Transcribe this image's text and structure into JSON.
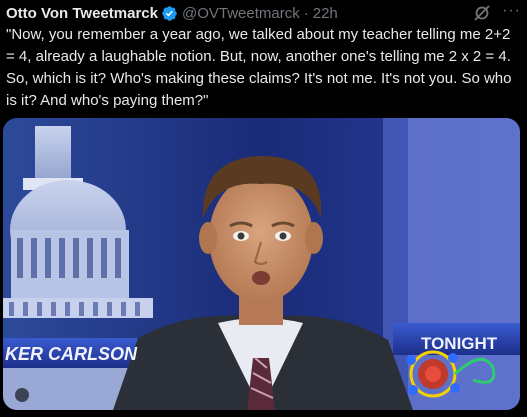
{
  "tweet": {
    "author_name": "Otto Von Tweetmarck",
    "handle": "@OVTweetmarck",
    "separator": "·",
    "time": "22h",
    "more_glyph": "···",
    "text": "\"Now, you remember a year ago, we talked about my teacher telling me 2+2 = 4, already a laughable notion. But, now, another one's telling me 2 x 2 = 4. So, which is it? Who's making these claims? It's not me. It's not you. So who is it? And who's paying them?\""
  },
  "media": {
    "nameplate_text": "KER CARLSON",
    "tonight_text": "TONIGHT"
  },
  "colors": {
    "verified_blue": "#1d9bf0",
    "muted_text": "#71767b",
    "primary_text": "#e7e9ea",
    "background": "#000000"
  },
  "icons": [
    "verified-badge-icon",
    "grok-icon",
    "more-icon",
    "gif-badge-icon"
  ]
}
